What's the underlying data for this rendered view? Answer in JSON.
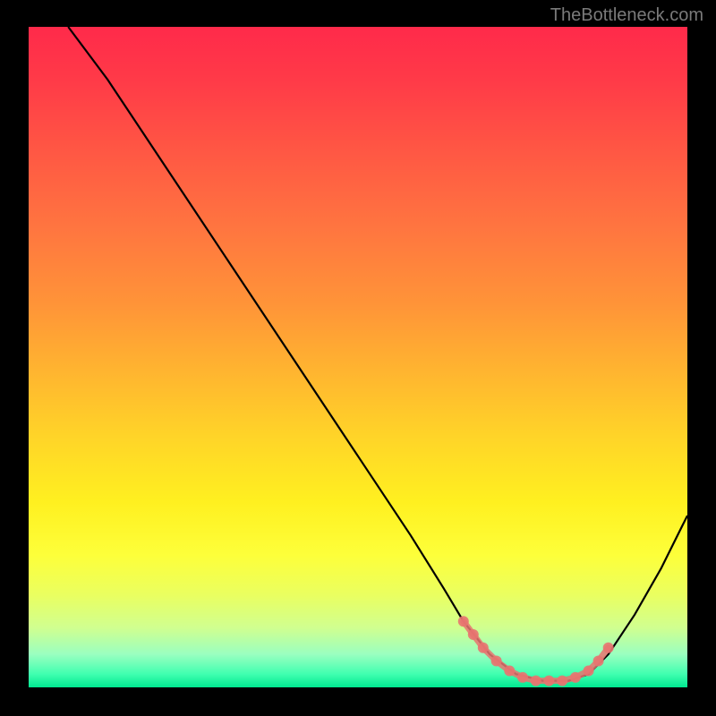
{
  "watermark": "TheBottleneck.com",
  "chart_data": {
    "type": "line",
    "title": "",
    "xlabel": "",
    "ylabel": "",
    "xlim": [
      0,
      100
    ],
    "ylim": [
      0,
      100
    ],
    "series": [
      {
        "name": "curve",
        "x": [
          6,
          12,
          20,
          30,
          40,
          50,
          58,
          63,
          66,
          70,
          74,
          78,
          82,
          85,
          88,
          92,
          96,
          100
        ],
        "y": [
          100,
          92,
          80,
          65,
          50,
          35,
          23,
          15,
          10,
          5,
          2,
          1,
          1,
          2,
          5,
          11,
          18,
          26
        ]
      }
    ],
    "highlight_zone": {
      "x_start": 66,
      "x_end": 88,
      "color": "#e87470",
      "points_x": [
        66,
        67.5,
        69,
        71,
        73,
        75,
        77,
        79,
        81,
        83,
        85,
        86.5,
        88
      ],
      "points_y": [
        10,
        8,
        6,
        4,
        2.5,
        1.5,
        1,
        1,
        1,
        1.5,
        2.5,
        4,
        6
      ]
    }
  }
}
